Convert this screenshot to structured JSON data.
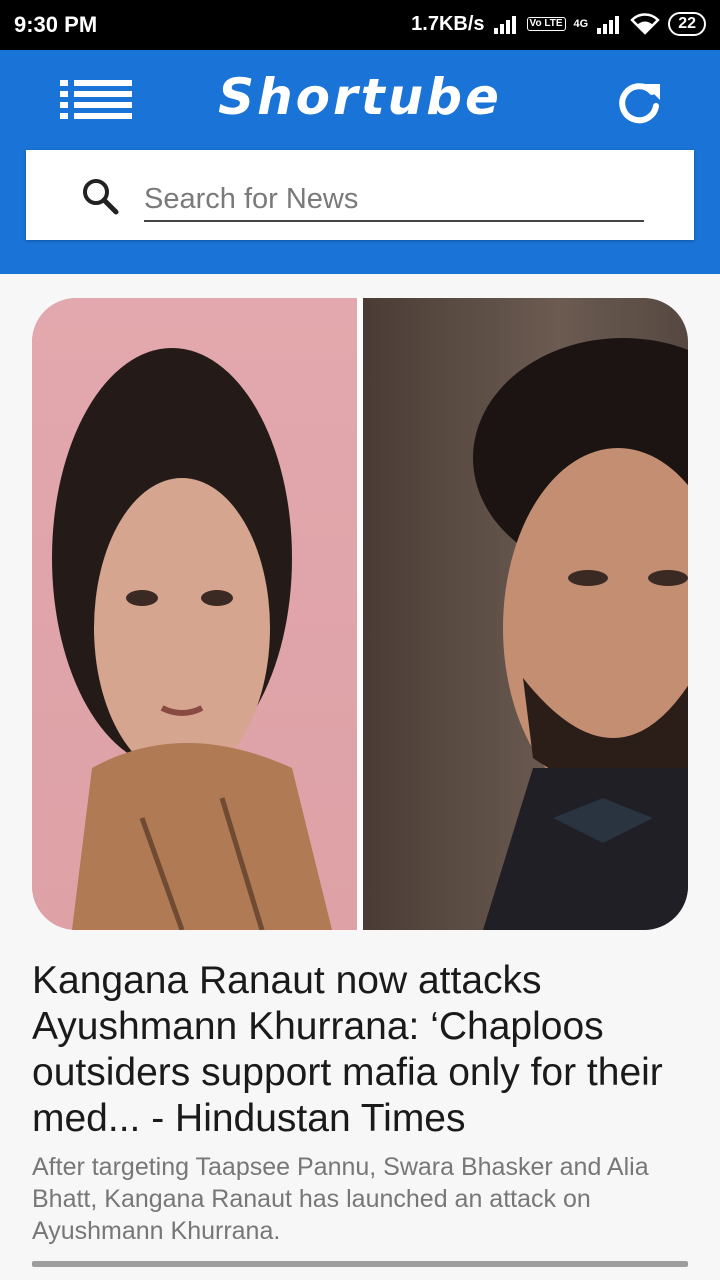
{
  "status_bar": {
    "time": "9:30 PM",
    "network_speed": "1.7KB/s",
    "volte": "Vo LTE",
    "network_type": "4G",
    "battery": "22"
  },
  "app_bar": {
    "title": "Shortube",
    "menu_icon": "list-menu-icon",
    "refresh_icon": "refresh-icon",
    "background_color": "#1a73d6"
  },
  "search": {
    "placeholder": "Search for News",
    "value": "",
    "icon": "search-icon"
  },
  "article": {
    "headline": "Kangana Ranaut now attacks Ayushmann Khurrana: ‘Chaploos outsiders support mafia only for their med... - Hindustan Times",
    "summary": "After targeting Taapsee Pannu, Swara Bhasker and Alia Bhatt, Kangana Ranaut has launched an attack on Ayushmann Khurrana."
  }
}
